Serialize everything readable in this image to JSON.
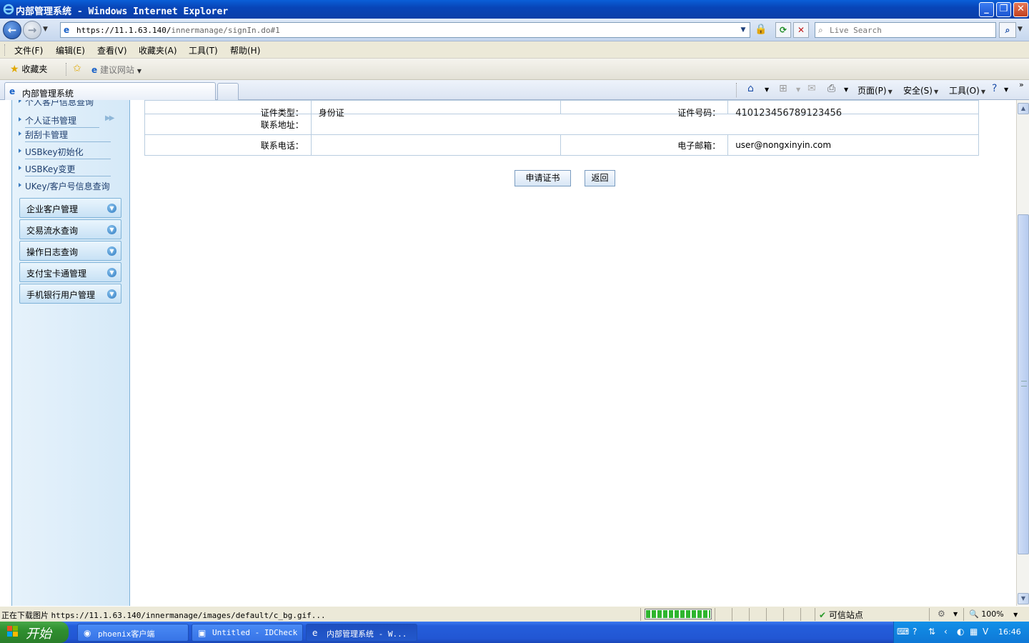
{
  "window": {
    "title": "内部管理系统 - Windows Internet Explorer",
    "min": "_",
    "max": "❐",
    "close": "✕"
  },
  "address": {
    "url_host": "https://11.1.63.140/",
    "url_path": "innermanage/signIn.do#1",
    "search_placeholder": "Live Search"
  },
  "menu": [
    "文件(F)",
    "编辑(E)",
    "查看(V)",
    "收藏夹(A)",
    "工具(T)",
    "帮助(H)"
  ],
  "favorites": {
    "fav_label": "收藏夹",
    "suggest_label": "建议网站"
  },
  "tab": {
    "label": "内部管理系统"
  },
  "commands": {
    "page": "页面(P)",
    "safety": "安全(S)",
    "tools": "工具(O)"
  },
  "sidebar": {
    "cut_item": "个人客户信息查询",
    "links": [
      "个人证书管理",
      "刮刮卡管理",
      "USBkey初始化",
      "USBKey变更",
      "UKey/客户号信息查询"
    ],
    "groups": [
      "企业客户管理",
      "交易流水查询",
      "操作日志查询",
      "支付宝卡通管理",
      "手机银行用户管理"
    ]
  },
  "form": {
    "row0": {
      "label1": "证件类型：",
      "value1": "身份证",
      "label2": "证件号码：",
      "value2": "410123456789123456"
    },
    "row1": {
      "label1": "联系地址：",
      "value1": ""
    },
    "row2": {
      "label1": "联系电话：",
      "value1": "",
      "label2": "电子邮箱：",
      "value2": "user@nongxinyin.com"
    },
    "apply_button": "申请证书",
    "back_button": "返回"
  },
  "status": {
    "prefix": "正在下载图片",
    "url": "https://11.1.63.140/innermanage/images/default/c_bg.gif...",
    "progress": 1.0,
    "zone": "可信站点",
    "zoom": "100%"
  },
  "taskbar": {
    "start": "开始",
    "items": [
      "phoenix客户端",
      "Untitled - IDCheck",
      "内部管理系统 - W..."
    ],
    "clock": "16:46"
  },
  "colors": {
    "sidebar_bg": "#d5e9f8",
    "title_blue": "#0845b8",
    "trusted_green": "#2a9a2a"
  }
}
